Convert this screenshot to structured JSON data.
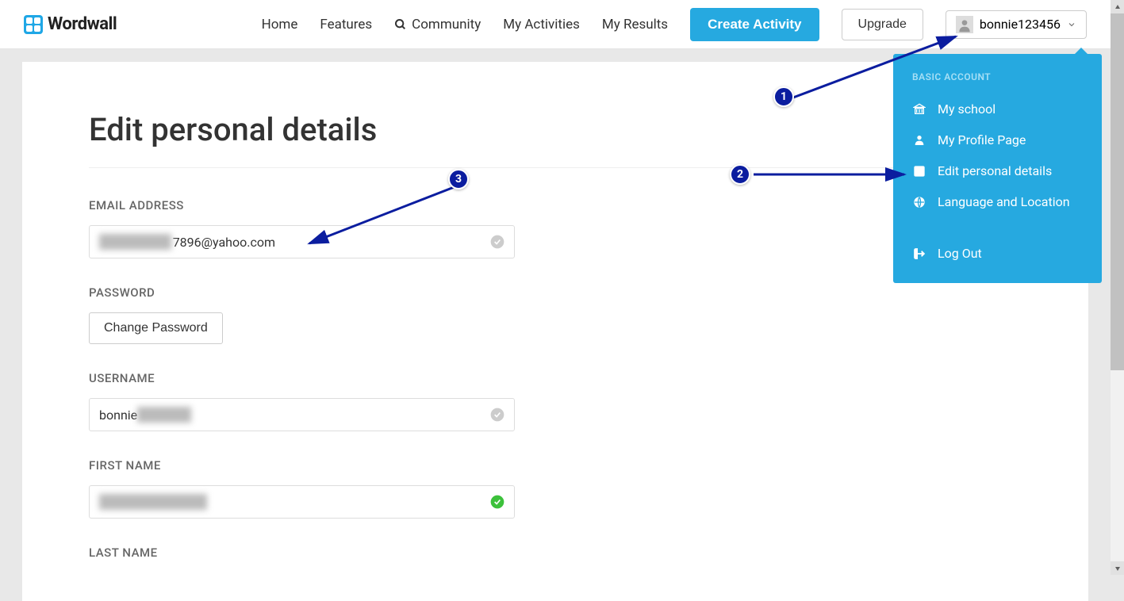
{
  "header": {
    "logo_text": "Wordwall",
    "nav_items": {
      "home": "Home",
      "features": "Features",
      "community": "Community",
      "activities": "My Activities",
      "results": "My Results"
    },
    "create_button": "Create Activity",
    "upgrade_button": "Upgrade",
    "username": "bonnie123456"
  },
  "dropdown": {
    "section_label": "BASIC ACCOUNT",
    "items": {
      "school": "My school",
      "profile": "My Profile Page",
      "edit": "Edit personal details",
      "lang": "Language and Location",
      "logout": "Log Out"
    }
  },
  "page": {
    "title": "Edit personal details",
    "labels": {
      "email": "EMAIL ADDRESS",
      "password": "PASSWORD",
      "username": "USERNAME",
      "firstname": "FIRST NAME",
      "lastname": "LAST NAME"
    },
    "email_value": "7896@yahoo.com",
    "email_prefix_hidden": "████████",
    "change_password": "Change Password",
    "username_value": "bonnie",
    "username_suffix_hidden": "██████",
    "firstname_hidden": "████████████"
  },
  "annotations": {
    "one": "1",
    "two": "2",
    "three": "3"
  }
}
